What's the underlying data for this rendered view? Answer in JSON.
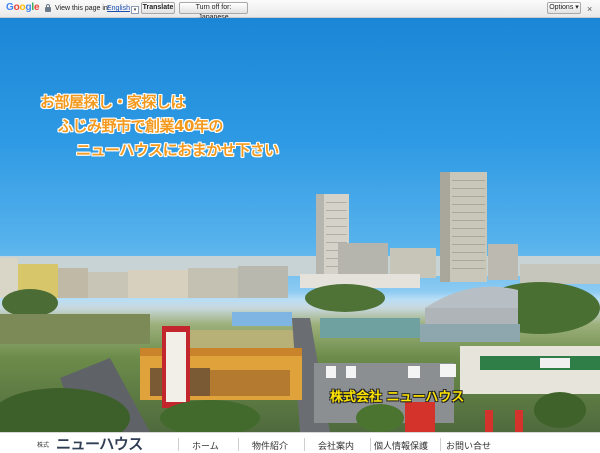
{
  "translate_bar": {
    "google_letters": [
      "G",
      "o",
      "o",
      "g",
      "l",
      "e"
    ],
    "google_colors": [
      "#4285f4",
      "#ea4335",
      "#fbbc05",
      "#4285f4",
      "#34a853",
      "#ea4335"
    ],
    "view_text": "View this page in:",
    "language": "English",
    "translate_label": "Translate",
    "turn_off_label": "Turn off for: Japanese",
    "options_label": "Options ▾",
    "close_glyph": "×"
  },
  "hero": {
    "catch_line1": "お部屋探し・家探しは",
    "catch_line2": "ふじみ野市で創業40年の",
    "catch_line3": "ニューハウスにおまかせ下さい",
    "company_sign": "株式会社 ニューハウス",
    "catch_color": "#f39a1e"
  },
  "nav": {
    "logo_prefix": "株式",
    "logo_name": "ニューハウス",
    "items": [
      "ホーム",
      "物件紹介",
      "会社案内",
      "個人情報保護",
      "お問い合せ"
    ]
  }
}
